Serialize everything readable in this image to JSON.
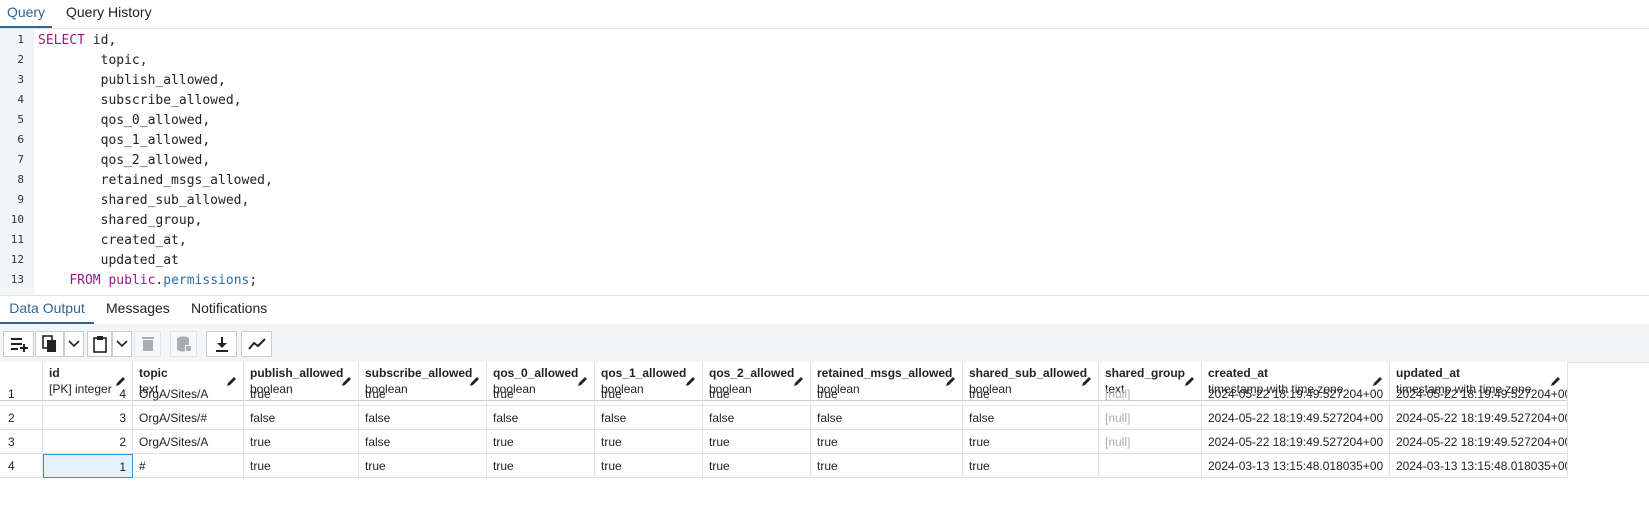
{
  "query_tabs": [
    "Query",
    "Query History"
  ],
  "editor": {
    "line_numbers": [
      "1",
      "2",
      "3",
      "4",
      "5",
      "6",
      "7",
      "8",
      "9",
      "10",
      "11",
      "12",
      "13"
    ],
    "lines": {
      "l1_kw": "SELECT",
      "l1_rest": " id,",
      "l2": "        topic,",
      "l3": "        publish_allowed,",
      "l4": "        subscribe_allowed,",
      "l5": "        qos_0_allowed,",
      "l6": "        qos_1_allowed,",
      "l7": "        qos_2_allowed,",
      "l8": "        retained_msgs_allowed,",
      "l9": "        shared_sub_allowed,",
      "l10": "        shared_group,",
      "l11": "        created_at,",
      "l12": "        updated_at",
      "l13_indent": "    ",
      "l13_from": "FROM",
      "l13_space": " ",
      "l13_schema": "public",
      "l13_dot": ".",
      "l13_table": "permissions",
      "l13_end": ";"
    }
  },
  "output_tabs": [
    "Data Output",
    "Messages",
    "Notifications"
  ],
  "toolbar": {
    "buttons": [
      "add-row",
      "copy",
      "copy-dropdown",
      "paste",
      "paste-dropdown",
      "delete",
      "save-data",
      "download",
      "graph"
    ]
  },
  "grid": {
    "columns": [
      {
        "name": "id",
        "type": "[PK] integer"
      },
      {
        "name": "topic",
        "type": "text"
      },
      {
        "name": "publish_allowed",
        "type": "boolean"
      },
      {
        "name": "subscribe_allowed",
        "type": "boolean"
      },
      {
        "name": "qos_0_allowed",
        "type": "boolean"
      },
      {
        "name": "qos_1_allowed",
        "type": "boolean"
      },
      {
        "name": "qos_2_allowed",
        "type": "boolean"
      },
      {
        "name": "retained_msgs_allowed",
        "type": "boolean"
      },
      {
        "name": "shared_sub_allowed",
        "type": "boolean"
      },
      {
        "name": "shared_group",
        "type": "text"
      },
      {
        "name": "created_at",
        "type": "timestamp with time zone"
      },
      {
        "name": "updated_at",
        "type": "timestamp with time zone"
      }
    ],
    "rows": [
      {
        "rownum": "1",
        "cells": [
          "4",
          "OrgA/Sites/A",
          "true",
          "true",
          "true",
          "true",
          "true",
          "true",
          "true",
          "[null]",
          "2024-05-22 18:19:49.527204+00",
          "2024-05-22 18:19:49.527204+00"
        ]
      },
      {
        "rownum": "2",
        "cells": [
          "3",
          "OrgA/Sites/#",
          "false",
          "false",
          "false",
          "false",
          "false",
          "false",
          "false",
          "[null]",
          "2024-05-22 18:19:49.527204+00",
          "2024-05-22 18:19:49.527204+00"
        ]
      },
      {
        "rownum": "3",
        "cells": [
          "2",
          "OrgA/Sites/A",
          "true",
          "false",
          "true",
          "true",
          "true",
          "true",
          "true",
          "[null]",
          "2024-05-22 18:19:49.527204+00",
          "2024-05-22 18:19:49.527204+00"
        ]
      },
      {
        "rownum": "4",
        "cells": [
          "1",
          "#",
          "true",
          "true",
          "true",
          "true",
          "true",
          "true",
          "true",
          "",
          "2024-03-13 13:15:48.018035+00",
          "2024-03-13 13:15:48.018035+00"
        ]
      }
    ]
  },
  "colors": {
    "accent": "#326690",
    "keyword": "#a0148c",
    "identifier": "#2c6ea8",
    "null_text": "#a9afb6",
    "selected_cell_border": "#3a8ed4"
  }
}
